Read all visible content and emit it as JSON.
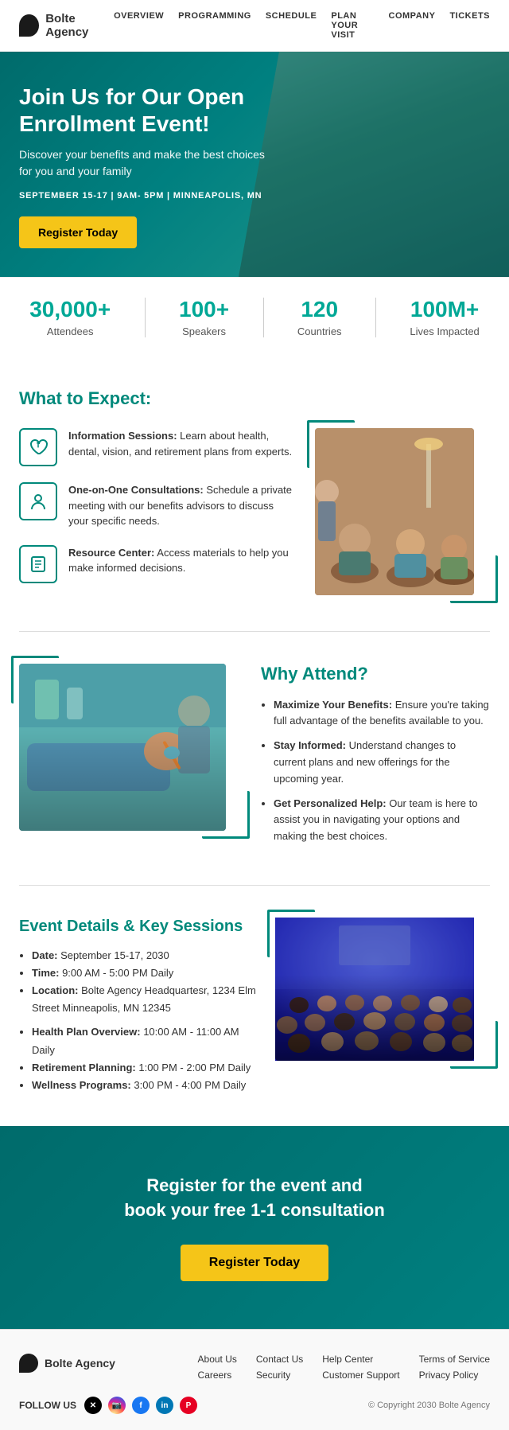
{
  "nav": {
    "logo_text": "Bolte Agency",
    "links": [
      "OVERVIEW",
      "PROGRAMMING",
      "SCHEDULE",
      "PLAN YOUR VISIT",
      "COMPANY",
      "TICKETS"
    ]
  },
  "hero": {
    "title": "Join Us for Our Open Enrollment Event!",
    "description": "Discover your benefits and make the best choices for you and your family",
    "date": "SEPTEMBER 15-17 | 9AM- 5PM | MINNEAPOLIS, MN",
    "register_btn": "Register Today"
  },
  "stats": [
    {
      "value": "30,000+",
      "label": "Attendees"
    },
    {
      "value": "100+",
      "label": "Speakers"
    },
    {
      "value": "120",
      "label": "Countries"
    },
    {
      "value": "100M+",
      "label": "Lives Impacted"
    }
  ],
  "what_to_expect": {
    "section_title": "What to Expect:",
    "items": [
      {
        "title": "Information Sessions:",
        "description": "Learn about health, dental, vision, and retirement plans from experts."
      },
      {
        "title": "One-on-One Consultations:",
        "description": "Schedule a private meeting with our benefits advisors to discuss your specific needs."
      },
      {
        "title": "Resource Center:",
        "description": "Access materials to help you make informed decisions."
      }
    ]
  },
  "why_attend": {
    "section_title": "Why Attend?",
    "items": [
      {
        "title": "Maximize Your Benefits:",
        "description": "Ensure you're taking full advantage of the benefits available to you."
      },
      {
        "title": "Stay Informed:",
        "description": "Understand changes to current plans and new offerings for the upcoming year."
      },
      {
        "title": "Get Personalized Help:",
        "description": "Our team is here to assist you in navigating your options and making the best choices."
      }
    ]
  },
  "event_details": {
    "section_title": "Event Details & Key Sessions",
    "details": [
      {
        "label": "Date:",
        "value": "September 15-17, 2030"
      },
      {
        "label": "Time:",
        "value": "9:00 AM - 5:00 PM Daily"
      },
      {
        "label": "Location:",
        "value": "Bolte Agency Headquartesr, 1234 Elm Street Minneapolis, MN 12345"
      }
    ],
    "sessions": [
      {
        "label": "Health Plan Overview:",
        "value": "10:00 AM - 11:00 AM Daily"
      },
      {
        "label": "Retirement Planning:",
        "value": "1:00 PM - 2:00 PM Daily"
      },
      {
        "label": "Wellness Programs:",
        "value": "3:00 PM - 4:00 PM Daily"
      }
    ]
  },
  "cta_footer": {
    "title": "Register for the event and\nbook your free 1-1 consultation",
    "register_btn": "Register Today"
  },
  "footer": {
    "logo_text": "Bolte Agency",
    "follow_label": "FOLLOW US",
    "copyright": "© Copyright 2030 Bolte Agency",
    "links_col1": [
      "About Us",
      "Careers"
    ],
    "links_col2": [
      "Contact Us",
      "Security"
    ],
    "links_col3": [
      "Help Center",
      "Customer Support"
    ],
    "links_col4": [
      "Terms of Service",
      "Privacy Policy"
    ],
    "social_icons": [
      "X",
      "📷",
      "f",
      "in",
      "P"
    ]
  }
}
